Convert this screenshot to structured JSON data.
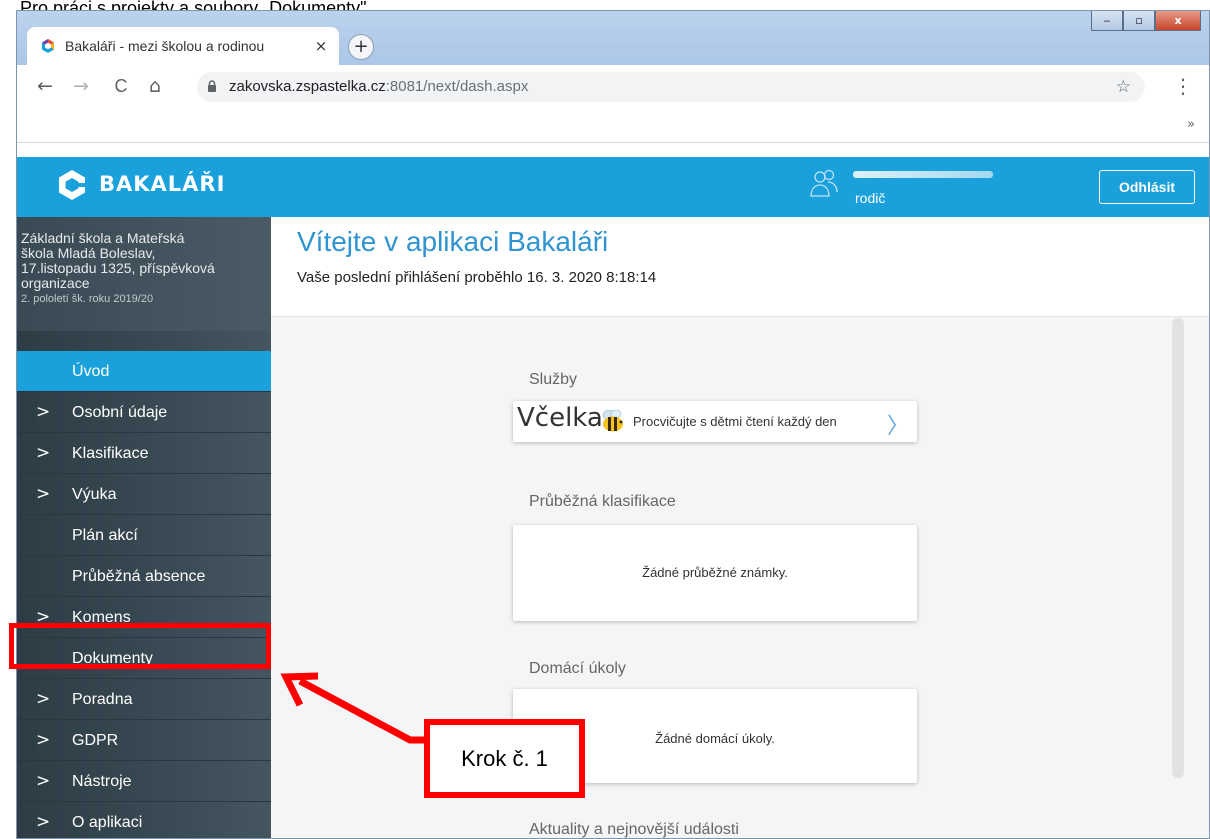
{
  "document": {
    "top_text": "Pro práci s projekty a soubory „Dokumenty\""
  },
  "browser": {
    "tab_title": "Bakaláři - mezi školou a rodinou",
    "tab_close": "×",
    "new_tab": "+",
    "url_host": "zakovska.zspastelka.cz",
    "url_path": ":8081/next/dash.aspx",
    "back": "←",
    "forward": "→",
    "reload": "C",
    "home": "⌂",
    "star": "☆",
    "menu": "⋮",
    "bookmarks_more": "»",
    "window_controls": [
      "‒",
      "▫",
      "x"
    ]
  },
  "app": {
    "brand": "BAKALÁŘI",
    "user_role": "rodič",
    "logout": "Odhlásit",
    "school": {
      "name_lines": [
        "Základní škola a Mateřská",
        "škola Mladá Boleslav,",
        "17.listopadu 1325, příspěvková",
        "organizace"
      ],
      "term": "2. pololetí šk. roku 2019/20"
    },
    "menu": [
      {
        "label": "Úvod",
        "chevron": ""
      },
      {
        "label": "Osobní údaje",
        "chevron": ">"
      },
      {
        "label": "Klasifikace",
        "chevron": ">"
      },
      {
        "label": "Výuka",
        "chevron": ">"
      },
      {
        "label": "Plán akcí",
        "chevron": ""
      },
      {
        "label": "Průběžná absence",
        "chevron": ""
      },
      {
        "label": "Komens",
        "chevron": ">"
      },
      {
        "label": "Dokumenty",
        "chevron": ""
      },
      {
        "label": "Poradna",
        "chevron": ">"
      },
      {
        "label": "GDPR",
        "chevron": ">"
      },
      {
        "label": "Nástroje",
        "chevron": ">"
      },
      {
        "label": "O aplikaci",
        "chevron": ">"
      }
    ],
    "welcome_title": "Vítejte v aplikaci Bakaláři",
    "last_login": "Vaše poslední přihlášení proběhlo 16. 3. 2020 8:18:14",
    "services": {
      "title": "Služby",
      "vcelka_word": "Včelka",
      "vcelka_text": "Procvičujte s dětmi čtení každý den",
      "chevron": "〉"
    },
    "grades": {
      "title": "Průběžná klasifikace",
      "empty": "Žádné průběžné známky."
    },
    "homework": {
      "title": "Domácí úkoly",
      "empty": "Žádné domácí úkoly."
    },
    "news": {
      "title": "Aktuality a nejnovější události"
    }
  },
  "annotation": {
    "label": "Krok č. 1",
    "color": "#ff0000"
  }
}
